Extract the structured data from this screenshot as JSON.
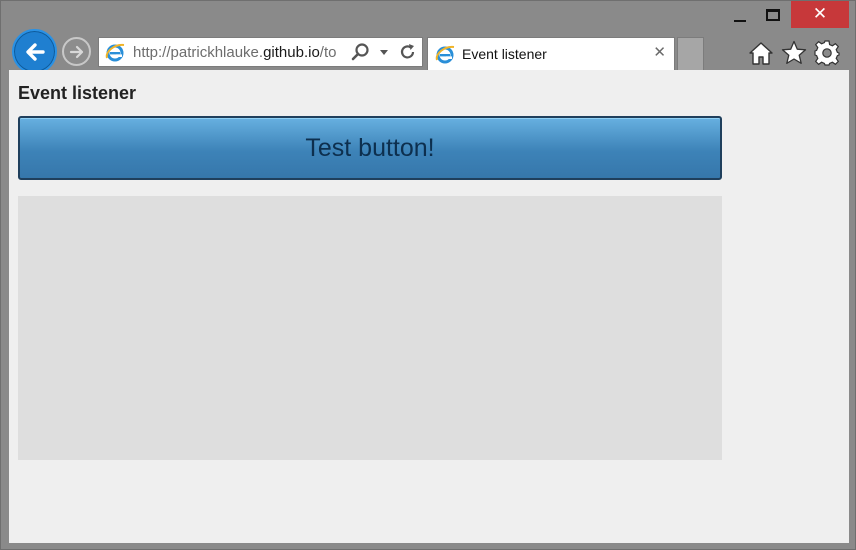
{
  "window": {
    "minimize_icon": "minimize-icon",
    "maximize_icon": "maximize-icon",
    "close_icon": "close-icon",
    "close_glyph": "✕",
    "close_color": "#c7383a"
  },
  "nav": {
    "back_icon": "back-arrow-icon",
    "forward_icon": "forward-arrow-icon",
    "accent_color": "#1f7fd0"
  },
  "address_bar": {
    "url_prefix": "http://patrickhlauke.",
    "url_domain": "github.io",
    "url_suffix": "/to",
    "icons": [
      "search-icon",
      "dropdown-arrow-icon",
      "refresh-icon"
    ]
  },
  "tab": {
    "title": "Event listener",
    "close_glyph": "✕"
  },
  "toolbar": {
    "icons": [
      "home-icon",
      "favorites-star-icon",
      "settings-gear-icon"
    ]
  },
  "page": {
    "heading": "Event listener",
    "button_label": "Test button!",
    "button_color": "#4a90c5",
    "output_bg": "#dedede"
  }
}
